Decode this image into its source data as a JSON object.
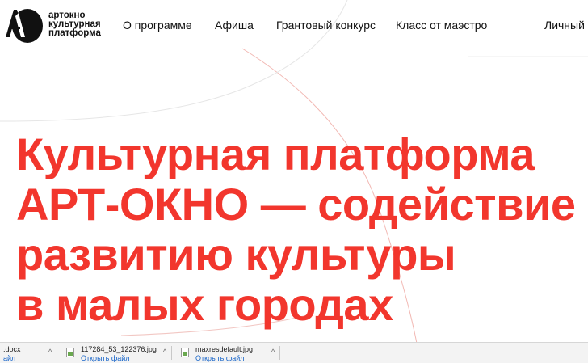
{
  "site": {
    "logo_lines": [
      "артокно",
      "культурная",
      "платформа"
    ]
  },
  "nav": {
    "items": [
      {
        "label": "О программе"
      },
      {
        "label": "Афиша"
      },
      {
        "label": "Грантовый конкурс"
      },
      {
        "label": "Класс от маэстро"
      },
      {
        "label": "Личный к"
      }
    ]
  },
  "hero": {
    "lines": [
      "Культурная платформа",
      "АРТ-ОКНО — содействие",
      "развитию культуры",
      "в малых городах"
    ]
  },
  "downloads": {
    "items": [
      {
        "name": ".docx",
        "action": "айл"
      },
      {
        "name": "117284_53_122376.jpg",
        "action": "Открыть файл"
      },
      {
        "name": "maxresdefault.jpg",
        "action": "Открыть файл"
      }
    ]
  },
  "colors": {
    "accent": "#f2362d",
    "link": "#1a66c9"
  }
}
